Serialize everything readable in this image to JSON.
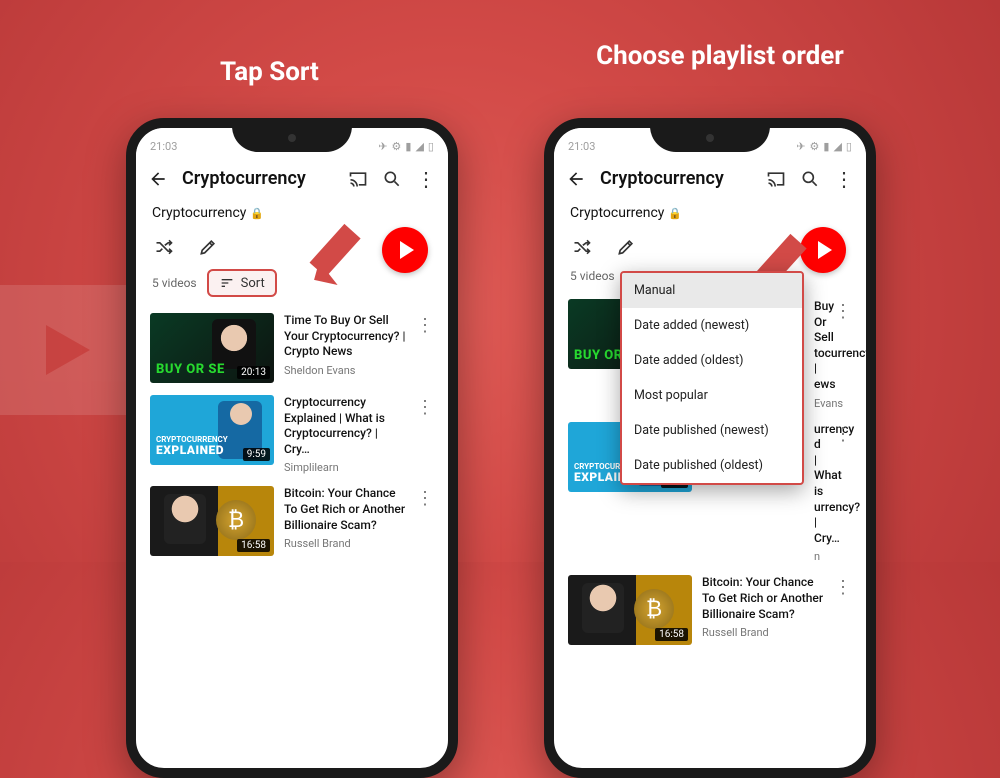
{
  "captions": {
    "left": "Tap Sort",
    "right": "Choose playlist order"
  },
  "status": {
    "time": "21:03"
  },
  "appbar": {
    "title": "Cryptocurrency"
  },
  "playlist": {
    "name": "Cryptocurrency",
    "count": "5 videos",
    "sort_label": "Sort"
  },
  "sort_options": [
    "Manual",
    "Date added (newest)",
    "Date added (oldest)",
    "Most popular",
    "Date published (newest)",
    "Date published (oldest)"
  ],
  "videos": [
    {
      "title": "Time To Buy Or Sell Your Cryptocurrency? | Crypto News",
      "channel": "Sheldon Evans",
      "duration": "20:13"
    },
    {
      "title": "Cryptocurrency Explained | What is Cryptocurrency? | Cry…",
      "channel": "Simplilearn",
      "duration": "9:59",
      "thumb_line1": "CRYPTOCURRENCY",
      "thumb_line2": "EXPLAINED"
    },
    {
      "title": "Bitcoin: Your Chance To Get Rich or Another Billionaire Scam?",
      "channel": "Russell Brand",
      "duration": "16:58"
    }
  ],
  "videos_right_clip": [
    {
      "l1": "Buy Or Sell",
      "l2": "tocurrency? |",
      "l3": "ews",
      "ch": "Evans"
    },
    {
      "l1": "urrency",
      "l2": "d | What is",
      "l3": "urrency? | Cry…",
      "ch": "n"
    }
  ]
}
